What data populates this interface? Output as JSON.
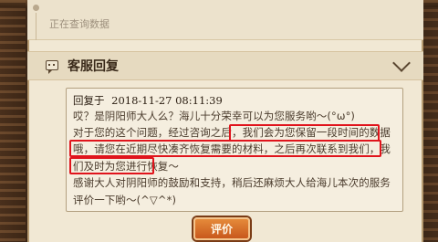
{
  "status": {
    "text": "正在查询数据"
  },
  "customer_service": {
    "title": "客服回复"
  },
  "reply": {
    "label": "回复于",
    "timestamp": "2018-11-27 08:11:39",
    "lines": [
      "哎？是阴阳师大人么？海儿十分荣幸可以为您服务哟～(°ω°)",
      "对于您的这个问题，经过咨询之后，我们会为您保留一段时间的数据",
      "哦，请您在近期尽快凑齐恢复需要的材料，之后再次联系到我们，我",
      "们及时为您进行恢复～",
      "感谢大人对阴阳师的鼓励和支持，稍后还麻烦大人给海儿本次的服务",
      "评价一下哟～(^▽^*)"
    ]
  },
  "actions": {
    "evaluate_label": "评价"
  },
  "colors": {
    "highlight": "#e0141c",
    "button": "#d66a28"
  },
  "icons": {
    "chat": "chat-bubble-icon",
    "collapse": "chevron-down-icon"
  }
}
